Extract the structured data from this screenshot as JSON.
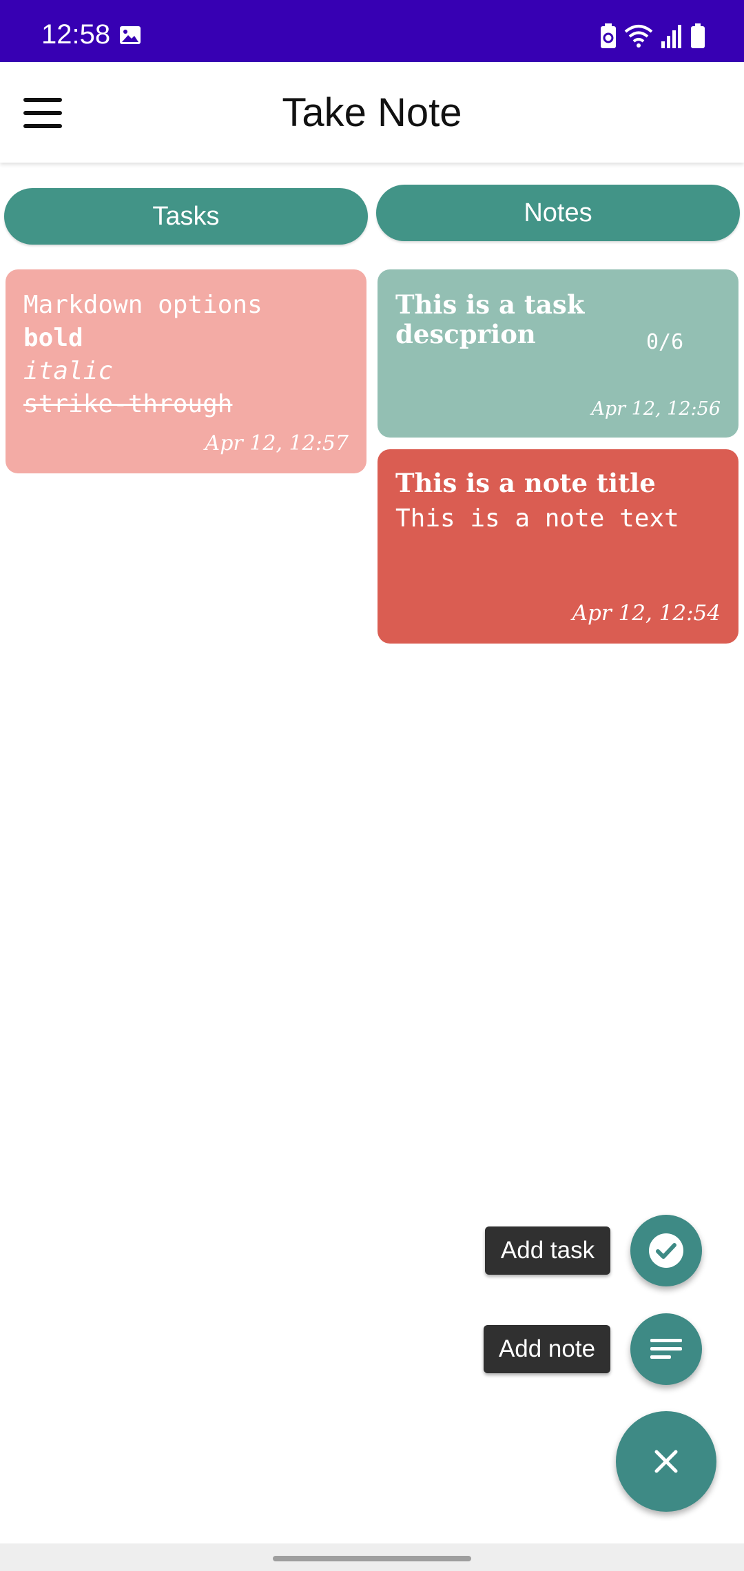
{
  "status_bar": {
    "time": "12:58"
  },
  "app_bar": {
    "title": "Take Note"
  },
  "tabs": {
    "tasks": "Tasks",
    "notes": "Notes"
  },
  "cards": [
    {
      "lines": [
        "Markdown options",
        "bold",
        "italic",
        "strike-through"
      ],
      "date": "Apr 12, 12:57",
      "color": "#f3aba5"
    },
    {
      "title": "This is a task descprion",
      "count": "0/6",
      "date": "Apr 12, 12:56",
      "color": "#93bfb3"
    },
    {
      "title": "This is a note title",
      "text": "This is a note text",
      "date": "Apr 12, 12:54",
      "color": "#da5d52"
    }
  ],
  "fab": {
    "add_task": "Add task",
    "add_note": "Add note"
  },
  "colors": {
    "status_bar": "#3700b3",
    "accent": "#429487",
    "fab": "#3e8a85"
  },
  "icons": {
    "menu": "hamburger-menu-icon",
    "task": "check-circle-icon",
    "note": "notes-lines-icon",
    "close": "close-icon"
  }
}
